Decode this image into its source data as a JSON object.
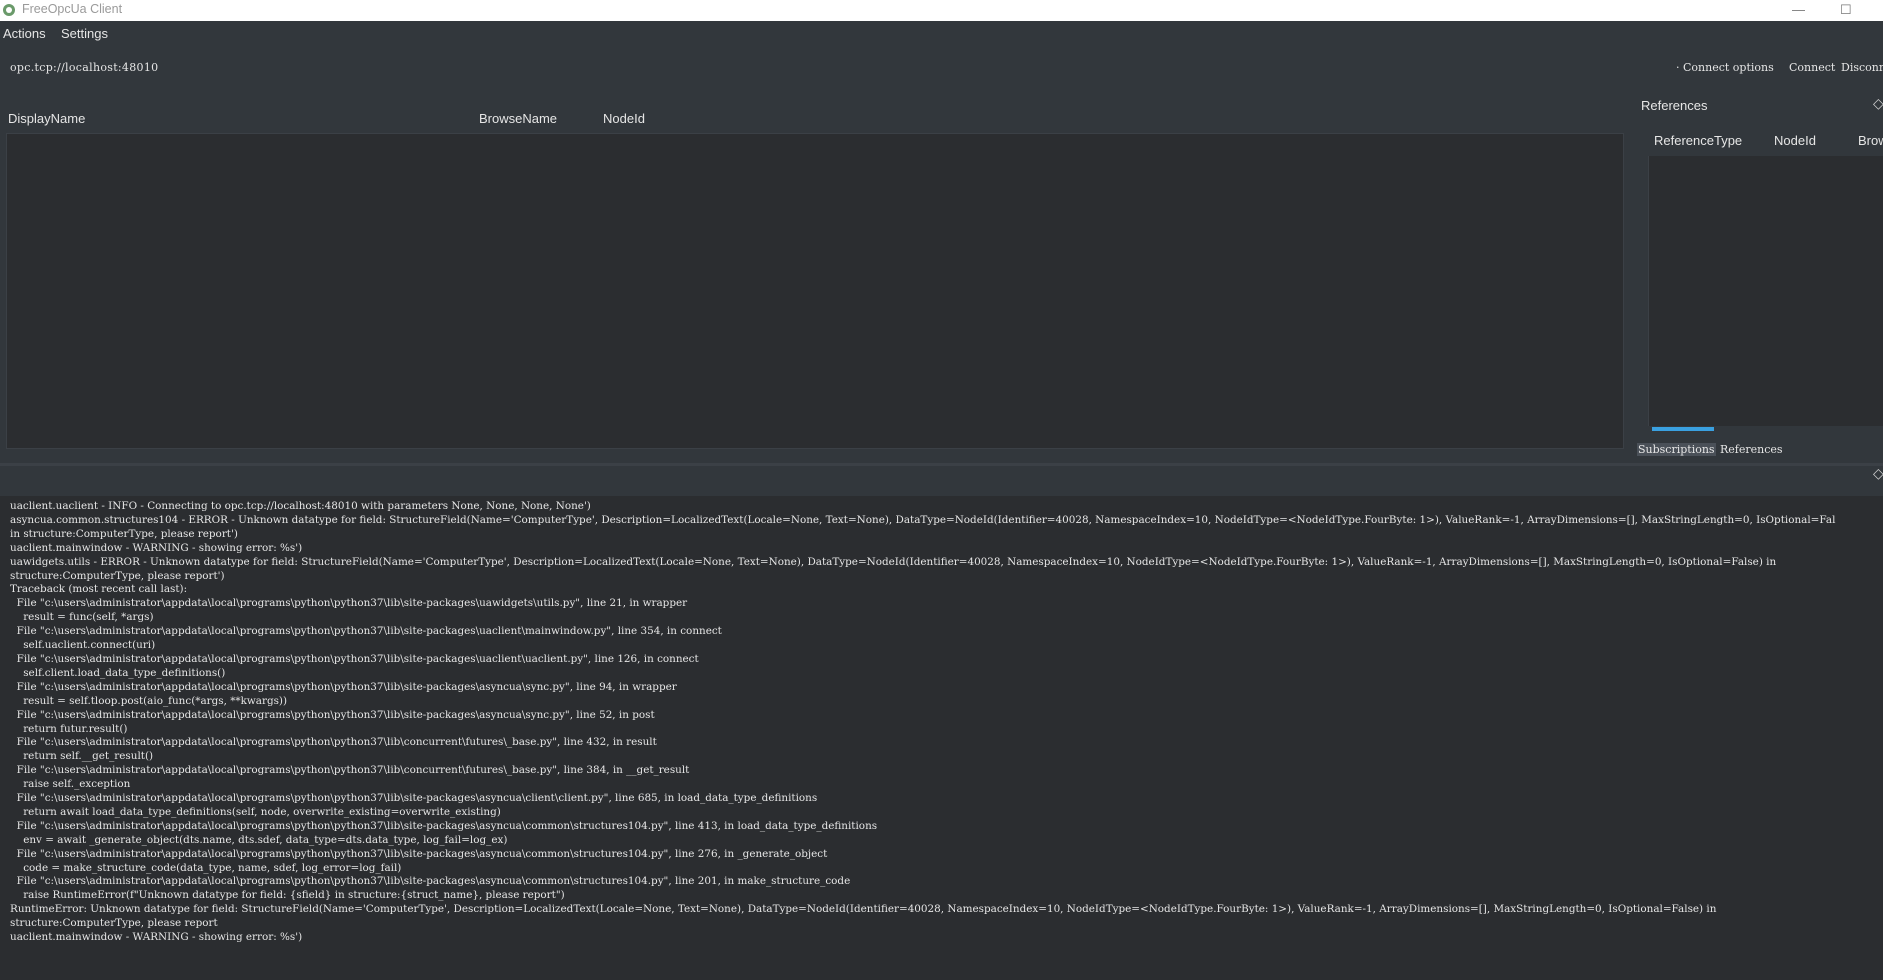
{
  "window": {
    "title": "FreeOpcUa Client",
    "minimize": "—",
    "maximize": "☐"
  },
  "menu": {
    "items": [
      "Actions",
      "Settings"
    ]
  },
  "toolbar": {
    "url": "opc.tcp://localhost:48010",
    "connect_options_label": "Connect options",
    "connect_label": "Connect",
    "disconnect_label": "Disconn"
  },
  "tree": {
    "columns": [
      "DisplayName",
      "BrowseName",
      "NodeId"
    ]
  },
  "references": {
    "panel_title": "References",
    "columns": [
      "ReferenceType",
      "NodeId",
      "Brow"
    ]
  },
  "dock_tabs": [
    "Subscriptions",
    "References"
  ],
  "log": {
    "lines": [
      "uaclient.uaclient - INFO - Connecting to opc.tcp://localhost:48010 with parameters None, None, None, None')",
      "asyncua.common.structures104 - ERROR - Unknown datatype for field: StructureField(Name='ComputerType', Description=LocalizedText(Locale=None, Text=None), DataType=NodeId(Identifier=40028, NamespaceIndex=10, NodeIdType=<NodeIdType.FourByte: 1>), ValueRank=-1, ArrayDimensions=[], MaxStringLength=0, IsOptional=Fal",
      "in structure:ComputerType, please report')",
      "uaclient.mainwindow - WARNING - showing error: %s')",
      "uawidgets.utils - ERROR - Unknown datatype for field: StructureField(Name='ComputerType', Description=LocalizedText(Locale=None, Text=None), DataType=NodeId(Identifier=40028, NamespaceIndex=10, NodeIdType=<NodeIdType.FourByte: 1>), ValueRank=-1, ArrayDimensions=[], MaxStringLength=0, IsOptional=False) in",
      "structure:ComputerType, please report')",
      "Traceback (most recent call last):",
      "  File \"c:\\users\\administrator\\appdata\\local\\programs\\python\\python37\\lib\\site-packages\\uawidgets\\utils.py\", line 21, in wrapper",
      "    result = func(self, *args)",
      "  File \"c:\\users\\administrator\\appdata\\local\\programs\\python\\python37\\lib\\site-packages\\uaclient\\mainwindow.py\", line 354, in connect",
      "    self.uaclient.connect(uri)",
      "  File \"c:\\users\\administrator\\appdata\\local\\programs\\python\\python37\\lib\\site-packages\\uaclient\\uaclient.py\", line 126, in connect",
      "    self.client.load_data_type_definitions()",
      "  File \"c:\\users\\administrator\\appdata\\local\\programs\\python\\python37\\lib\\site-packages\\asyncua\\sync.py\", line 94, in wrapper",
      "    result = self.tloop.post(aio_func(*args, **kwargs))",
      "  File \"c:\\users\\administrator\\appdata\\local\\programs\\python\\python37\\lib\\site-packages\\asyncua\\sync.py\", line 52, in post",
      "    return futur.result()",
      "  File \"c:\\users\\administrator\\appdata\\local\\programs\\python\\python37\\lib\\concurrent\\futures\\_base.py\", line 432, in result",
      "    return self.__get_result()",
      "  File \"c:\\users\\administrator\\appdata\\local\\programs\\python\\python37\\lib\\concurrent\\futures\\_base.py\", line 384, in __get_result",
      "    raise self._exception",
      "  File \"c:\\users\\administrator\\appdata\\local\\programs\\python\\python37\\lib\\site-packages\\asyncua\\client\\client.py\", line 685, in load_data_type_definitions",
      "    return await load_data_type_definitions(self, node, overwrite_existing=overwrite_existing)",
      "  File \"c:\\users\\administrator\\appdata\\local\\programs\\python\\python37\\lib\\site-packages\\asyncua\\common\\structures104.py\", line 413, in load_data_type_definitions",
      "    env = await _generate_object(dts.name, dts.sdef, data_type=dts.data_type, log_fail=log_ex)",
      "  File \"c:\\users\\administrator\\appdata\\local\\programs\\python\\python37\\lib\\site-packages\\asyncua\\common\\structures104.py\", line 276, in _generate_object",
      "    code = make_structure_code(data_type, name, sdef, log_error=log_fail)",
      "  File \"c:\\users\\administrator\\appdata\\local\\programs\\python\\python37\\lib\\site-packages\\asyncua\\common\\structures104.py\", line 201, in make_structure_code",
      "    raise RuntimeError(f\"Unknown datatype for field: {sfield} in structure:{struct_name}, please report\")",
      "RuntimeError: Unknown datatype for field: StructureField(Name='ComputerType', Description=LocalizedText(Locale=None, Text=None), DataType=NodeId(Identifier=40028, NamespaceIndex=10, NodeIdType=<NodeIdType.FourByte: 1>), ValueRank=-1, ArrayDimensions=[], MaxStringLength=0, IsOptional=False) in",
      "structure:ComputerType, please report",
      "uaclient.mainwindow - WARNING - showing error: %s')"
    ]
  }
}
